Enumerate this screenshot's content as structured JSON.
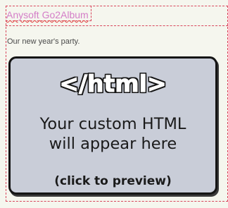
{
  "album": {
    "title": "Anysoft Go2Album",
    "caption": "Our new year's party."
  },
  "html_placeholder": {
    "tag": "</html>",
    "line1": "Your custom HTML",
    "line2": "will appear here",
    "preview_label": "(click to preview)"
  },
  "colors": {
    "background": "#f5f6ee",
    "dashed_border": "#d8455b",
    "title_link": "#d47ec8",
    "placeholder_fill": "#c9cdd8"
  }
}
